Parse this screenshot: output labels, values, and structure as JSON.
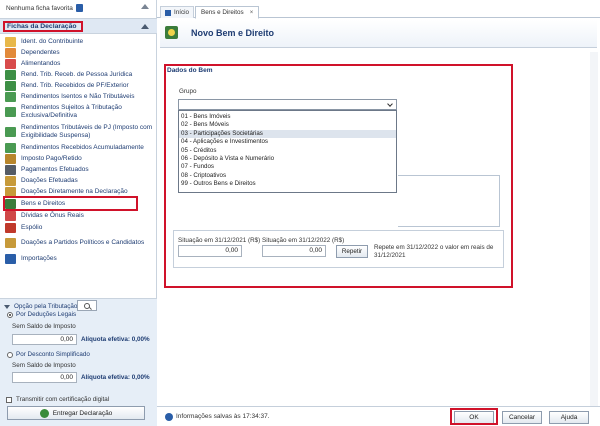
{
  "sidebar": {
    "favorites_label": "Nenhuma ficha favorita",
    "section_title": "Fichas da Declaração",
    "items": [
      {
        "label": "Ident. do Contribuinte",
        "icon": "person-id-icon",
        "color": "#e8b84a"
      },
      {
        "label": "Dependentes",
        "icon": "people-icon",
        "color": "#e28a3a"
      },
      {
        "label": "Alimentandos",
        "icon": "people-group-icon",
        "color": "#d84b4b"
      },
      {
        "label": "Rend. Trib. Receb. de Pessoa Jurídica",
        "icon": "money-building-icon",
        "color": "#3d8f45"
      },
      {
        "label": "Rend. Trib. Recebidos de PF/Exterior",
        "icon": "money-globe-icon",
        "color": "#3d8f45"
      },
      {
        "label": "Rendimentos Isentos e Não Tributáveis",
        "icon": "money-exempt-icon",
        "color": "#4a9a52"
      },
      {
        "label": "Rendimentos Sujeitos à Tributação Exclusiva/Definitiva",
        "icon": "money-exclusive-icon",
        "color": "#4a9a52"
      },
      {
        "label": "Rendimentos Tributáveis de PJ (Imposto com Exigibilidade Suspensa)",
        "icon": "money-suspended-icon",
        "color": "#4a9a52"
      },
      {
        "label": "Rendimentos Recebidos Acumuladamente",
        "icon": "money-stack-icon",
        "color": "#4a9a52"
      },
      {
        "label": "Imposto Pago/Retido",
        "icon": "tax-paid-icon",
        "color": "#b8862c"
      },
      {
        "label": "Pagamentos Efetuados",
        "icon": "payment-icon",
        "color": "#555c66"
      },
      {
        "label": "Doações Efetuadas",
        "icon": "donation-icon",
        "color": "#c79a3a"
      },
      {
        "label": "Doações Diretamente na Declaração",
        "icon": "donation-direct-icon",
        "color": "#c79a3a"
      },
      {
        "label": "Bens e Direitos",
        "icon": "assets-icon",
        "color": "#3b7c3b"
      },
      {
        "label": "Dívidas e Ônus Reais",
        "icon": "debt-icon",
        "color": "#d04848"
      },
      {
        "label": "Espólio",
        "icon": "estate-icon",
        "color": "#c0392b"
      },
      {
        "label": "Doações a Partidos Políticos e Candidatos",
        "icon": "political-donation-icon",
        "color": "#c79a3a"
      },
      {
        "label": "Importações",
        "icon": "import-icon",
        "color": "#2a5ea8"
      }
    ],
    "active_index": 13
  },
  "opcao": {
    "title": "Opção pela Tributação:",
    "legais_label": "Por Deduções Legais",
    "legais_saldo_label": "Sem Saldo de Imposto",
    "legais_value": "0,00",
    "legais_aliquota": "Alíquota efetiva: 0,00%",
    "simplificado_label": "Por Desconto Simplificado",
    "simplificado_saldo_label": "Sem Saldo de Imposto",
    "simplificado_value": "0,00",
    "simplificado_aliquota": "Alíquota efetiva: 0,00%",
    "cert_label": "Transmitir com certificação digital",
    "entregar_label": "Entregar Declaração"
  },
  "tabs": {
    "home_label": "Início",
    "active_label": "Bens e Direitos",
    "close_glyph": "×"
  },
  "page": {
    "title": "Novo Bem e Direito"
  },
  "form": {
    "section_title": "Dados do Bem",
    "grupo_label": "Grupo",
    "grupo_options": [
      "01 - Bens Imóveis",
      "02 - Bens Móveis",
      "03 - Participações Societárias",
      "04 - Aplicações e Investimentos",
      "05 - Créditos",
      "06 - Depósito à Vista e Numerário",
      "07 - Fundos",
      "08 - Criptoativos",
      "99 - Outros Bens e Direitos"
    ],
    "highlighted_index": 2,
    "situacao_2021_label": "Situação em 31/12/2021 (R$)",
    "situacao_2021_value": "0,00",
    "situacao_2022_label": "Situação em 31/12/2022 (R$)",
    "situacao_2022_value": "0,00",
    "repetir_label": "Repetir",
    "repete_text": "Repete em 31/12/2022 o valor em reais de 31/12/2021"
  },
  "footer": {
    "status": "Informações salvas às 17:34:37.",
    "ok_label": "OK",
    "cancel_label": "Cancelar",
    "help_label": "Ajuda"
  }
}
